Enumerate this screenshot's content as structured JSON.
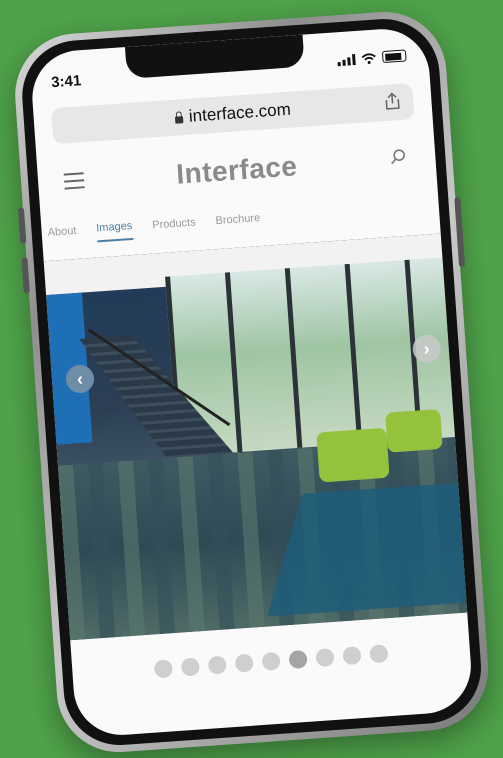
{
  "status_bar": {
    "time": "3:41"
  },
  "browser": {
    "url": "interface.com"
  },
  "site": {
    "brand": "Interface",
    "tabs": [
      {
        "label": "About",
        "active": false
      },
      {
        "label": "Images",
        "active": true
      },
      {
        "label": "Products",
        "active": false
      },
      {
        "label": "Brochure",
        "active": false
      }
    ]
  },
  "gallery": {
    "dot_count": 9,
    "active_dot": 5
  },
  "colors": {
    "background": "#4fa24a",
    "accent": "#4c7fa6"
  }
}
